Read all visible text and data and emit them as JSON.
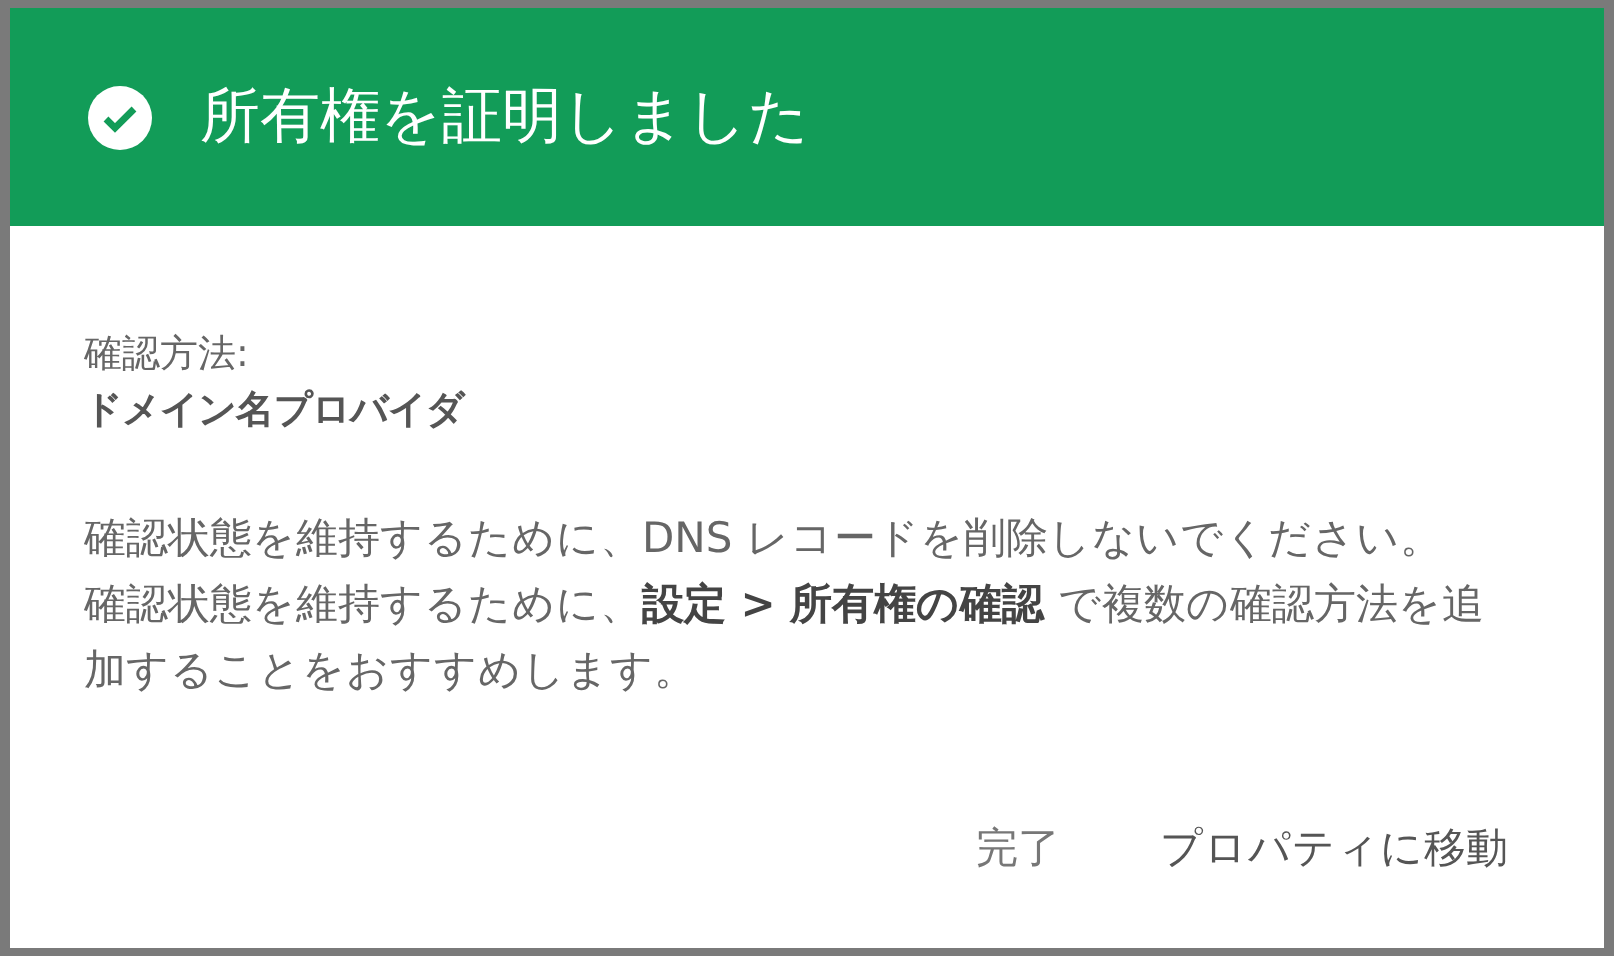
{
  "dialog": {
    "title": "所有権を証明しました",
    "method_label": "確認方法:",
    "method_value": "ドメイン名プロバイダ",
    "paragraphs": [
      "確認状態を維持するために、DNS レコードを削除しないでください。",
      "確認状態を維持するために、**設定 > 所有権の確認** で複数の確認方法を追加することをおすすめします。"
    ],
    "buttons": [
      {
        "label": "完了",
        "kind": "secondary"
      },
      {
        "label": "プロパティに移動",
        "kind": "primary"
      }
    ]
  }
}
